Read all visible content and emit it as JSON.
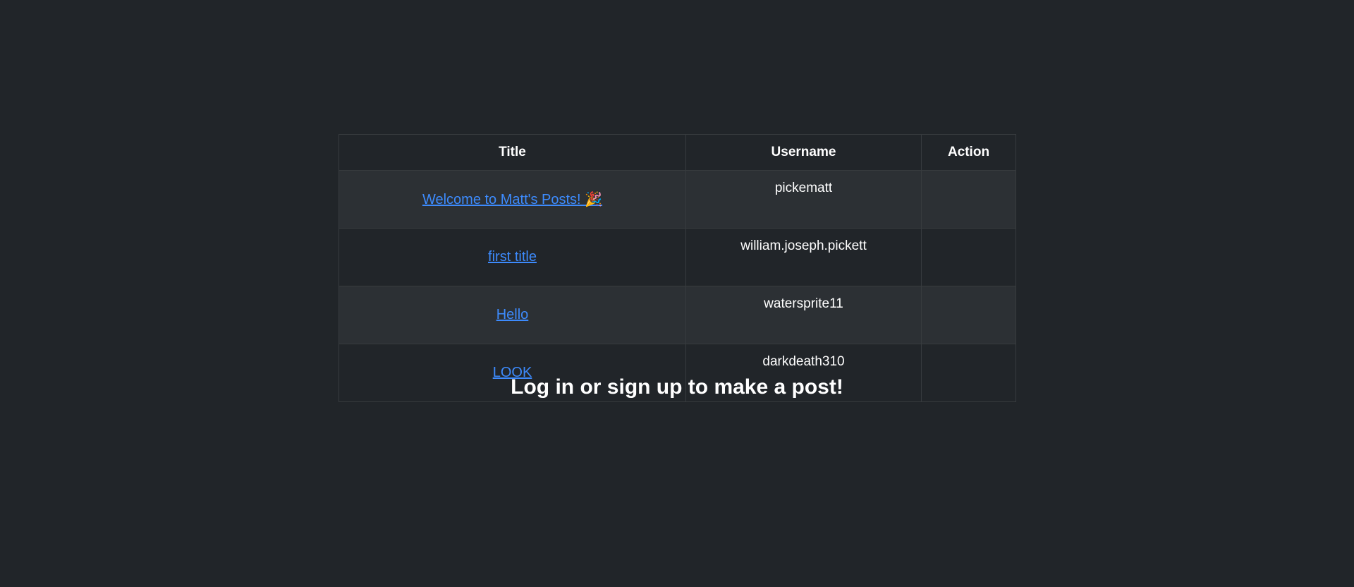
{
  "table": {
    "headers": {
      "title": "Title",
      "username": "Username",
      "action": "Action"
    },
    "rows": [
      {
        "title": "Welcome to Matt's Posts! 🎉",
        "username": "pickematt",
        "action": ""
      },
      {
        "title": "first title",
        "username": "william.joseph.pickett",
        "action": ""
      },
      {
        "title": "Hello",
        "username": "watersprite11",
        "action": ""
      },
      {
        "title": "LOOK",
        "username": "darkdeath310",
        "action": ""
      }
    ]
  },
  "footer": {
    "cta_text": "Log in or sign up to make a post!"
  },
  "colors": {
    "background": "#212529",
    "striped_row": "#2c3034",
    "link": "#3d8bfd",
    "border": "#373b3e"
  }
}
